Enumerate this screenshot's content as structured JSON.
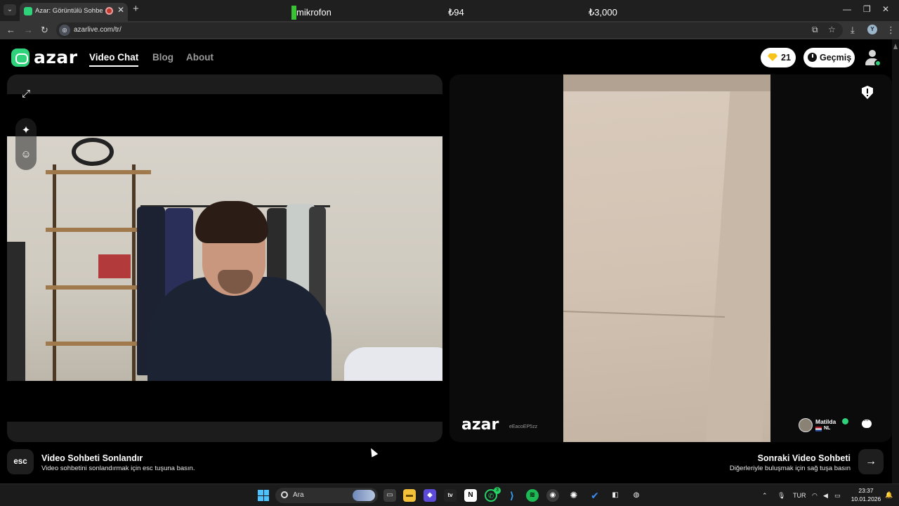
{
  "browser": {
    "tab_title": "Azar: Görüntülü Sohbet & V",
    "url": "azarlive.com/tr/",
    "profile_initial": "Y"
  },
  "overlay": {
    "mic_label": "mikrofon",
    "amount_small": "₺94",
    "amount_large": "₺3,000"
  },
  "header": {
    "logo_text": "azar",
    "nav": [
      {
        "label": "Video Chat",
        "active": true
      },
      {
        "label": "Blog",
        "active": false
      },
      {
        "label": "About",
        "active": false
      }
    ],
    "gems_count": "21",
    "history_label": "Geçmiş"
  },
  "partner": {
    "watermark": "azar",
    "session_code": "eEacoEP5zz",
    "name": "Matilda",
    "country": "NL"
  },
  "controls": {
    "esc_key": "esc",
    "end_title": "Video Sohbeti Sonlandır",
    "end_subtitle": "Video sohbetini sonlandırmak için esc tuşuna basın.",
    "next_title": "Sonraki Video Sohbeti",
    "next_subtitle": "Diğerleriyle buluşmak için sağ tuşa basın"
  },
  "taskbar": {
    "search_placeholder": "Ara",
    "whatsapp_badge": "3",
    "language": "TUR",
    "time": "23:37",
    "date": "10.01.2026"
  },
  "colors": {
    "brand_green": "#2fd27a",
    "gem_yellow": "#f6c21b",
    "mic_meter_green": "#39c236"
  }
}
